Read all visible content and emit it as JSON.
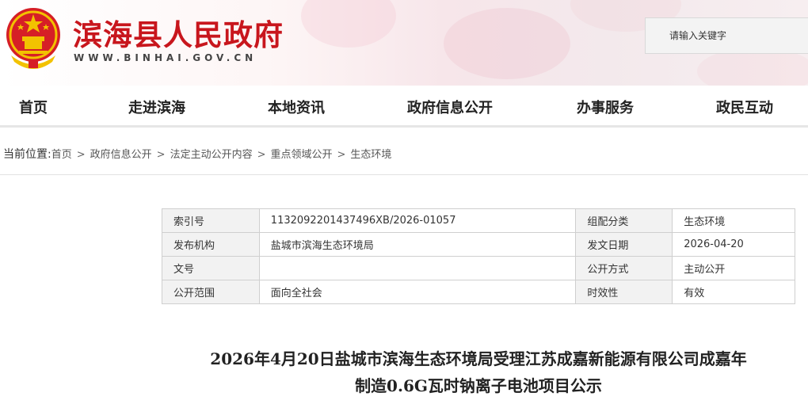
{
  "header": {
    "site_title": "滨海县人民政府",
    "site_url": "WWW.BINHAI.GOV.CN",
    "search_placeholder": "请输入关键字",
    "colors": {
      "brand_red": "#c8161d",
      "emblem_gold": "#f2c200"
    }
  },
  "nav": {
    "items": [
      "首页",
      "走进滨海",
      "本地资讯",
      "政府信息公开",
      "办事服务",
      "政民互动"
    ]
  },
  "breadcrumb": {
    "lead": "当前位置:",
    "items": [
      "首页",
      "政府信息公开",
      "法定主动公开内容",
      "重点领域公开",
      "生态环境"
    ],
    "separator": ">"
  },
  "info_table": {
    "rows": [
      [
        "索引号",
        "1132092201437496XB/2026-01057",
        "组配分类",
        "生态环境"
      ],
      [
        "发布机构",
        "盐城市滨海生态环境局",
        "发文日期",
        "2026-04-20"
      ],
      [
        "文号",
        "",
        "公开方式",
        "主动公开"
      ],
      [
        "公开范围",
        "面向全社会",
        "时效性",
        "有效"
      ]
    ]
  },
  "article": {
    "title_line1": "2026年4月20日盐城市滨海生态环境局受理江苏成嘉新能源有限公司成嘉年",
    "title_line2": "制造0.6G瓦时钠离子电池项目公示"
  }
}
